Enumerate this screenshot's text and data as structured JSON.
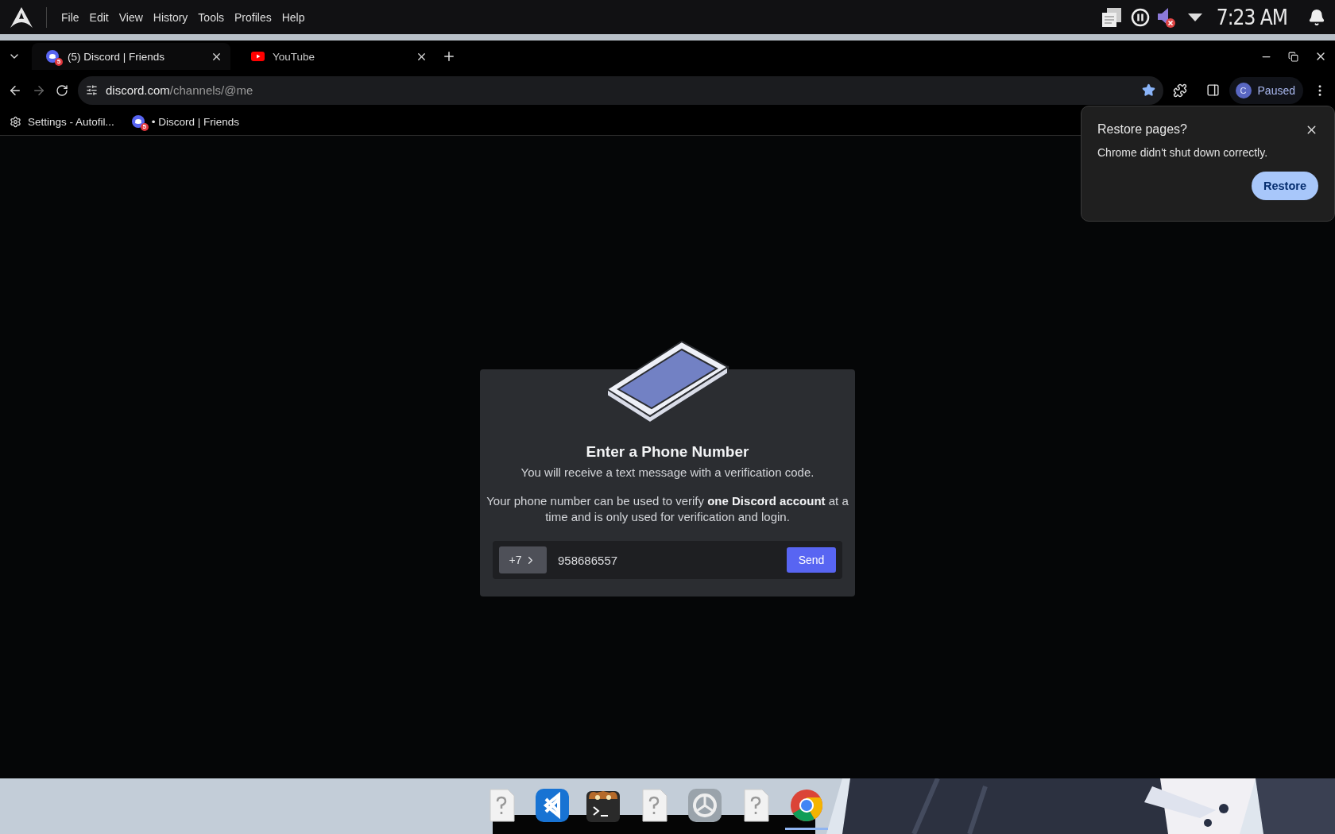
{
  "top_panel": {
    "menu": [
      "File",
      "Edit",
      "View",
      "History",
      "Tools",
      "Profiles",
      "Help"
    ],
    "clock": "7:23 AM"
  },
  "tabs": [
    {
      "title": "(5) Discord | Friends",
      "kind": "discord",
      "badge": "5",
      "selected": true
    },
    {
      "title": "YouTube",
      "kind": "youtube",
      "selected": false
    }
  ],
  "address_bar": {
    "host": "discord.com",
    "path": "/channels/@me",
    "bookmarked": true
  },
  "profile": {
    "initial": "C",
    "status": "Paused"
  },
  "bookmarks": [
    {
      "label": "Settings - Autofil...",
      "kind": "settings"
    },
    {
      "label": "• Discord | Friends",
      "kind": "discord",
      "badge": "5"
    }
  ],
  "restore_popup": {
    "title": "Restore pages?",
    "message": "Chrome didn't shut down correctly.",
    "button": "Restore"
  },
  "modal": {
    "title": "Enter a Phone Number",
    "subtitle": "You will receive a text message with a verification code.",
    "body": "Your phone number can be used to verify **one Discord account** at a time and is only used for verification and login.",
    "country_code": "+7",
    "phone": "958686557",
    "send": "Send"
  },
  "dock": [
    {
      "kind": "file",
      "active": false
    },
    {
      "kind": "vscode",
      "active": false
    },
    {
      "kind": "terminal",
      "active": false
    },
    {
      "kind": "file",
      "active": false
    },
    {
      "kind": "settings",
      "active": false
    },
    {
      "kind": "file",
      "active": false
    },
    {
      "kind": "chrome",
      "active": true
    }
  ]
}
